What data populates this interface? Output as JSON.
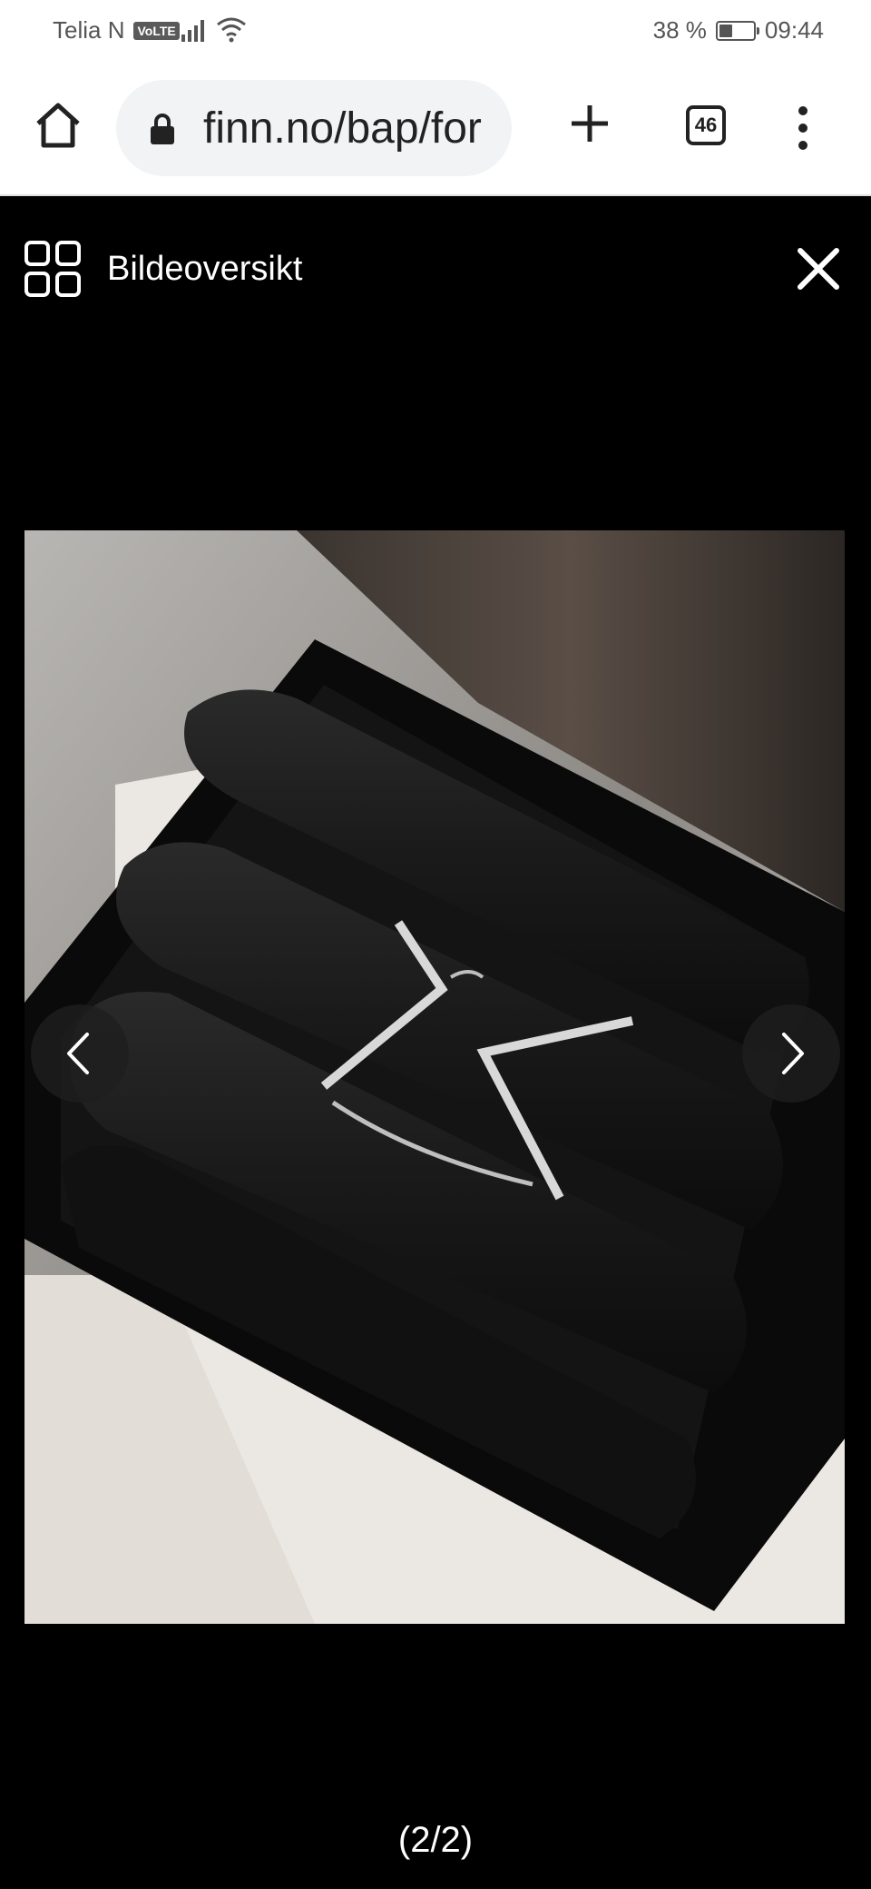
{
  "status_bar": {
    "carrier": "Telia N",
    "volte": "VoLTE",
    "battery_percent": "38 %",
    "battery_level": 0.38,
    "time": "09:44"
  },
  "browser": {
    "url": "finn.no/bap/for",
    "tab_count": "46"
  },
  "gallery": {
    "overview_label": "Bildeoversikt",
    "counter": "(2/2)"
  },
  "icons": [
    "home-icon",
    "lock-icon",
    "plus-icon",
    "more-vert-icon",
    "grid-icon",
    "close-icon",
    "chevron-left-icon",
    "chevron-right-icon"
  ]
}
